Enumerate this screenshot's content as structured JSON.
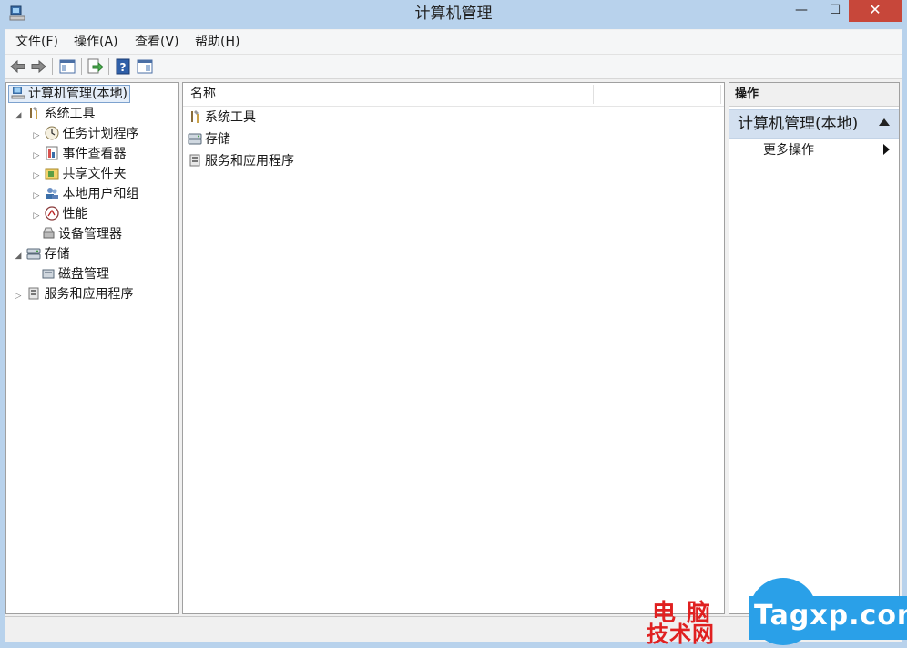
{
  "window": {
    "title": "计算机管理",
    "min_glyph": "—",
    "max_glyph": "☐",
    "close_glyph": "✕"
  },
  "menu": [
    "文件(F)",
    "操作(A)",
    "查看(V)",
    "帮助(H)"
  ],
  "toolbar": [
    "back-arrow-icon",
    "forward-arrow-icon",
    "console-tree-icon",
    "export-list-icon",
    "help-icon",
    "action-pane-icon"
  ],
  "tree": {
    "root": "计算机管理(本地)",
    "items": [
      {
        "label": "系统工具",
        "expanded": true
      },
      {
        "label": "任务计划程序"
      },
      {
        "label": "事件查看器"
      },
      {
        "label": "共享文件夹"
      },
      {
        "label": "本地用户和组"
      },
      {
        "label": "性能"
      },
      {
        "label": "设备管理器"
      },
      {
        "label": "存储",
        "expanded": true
      },
      {
        "label": "磁盘管理"
      },
      {
        "label": "服务和应用程序"
      }
    ]
  },
  "list": {
    "column_name": "名称",
    "rows": [
      "系统工具",
      "存储",
      "服务和应用程序"
    ]
  },
  "actions": {
    "header": "操作",
    "section": "计算机管理(本地)",
    "more": "更多操作"
  },
  "watermark": {
    "line1": "电脑",
    "line2": "技术网",
    "brand": "Tagxp.com"
  },
  "colors": {
    "titlebar": "#b8d2ec",
    "close": "#c7473a",
    "selection": "#d3e0f0",
    "watermark_blue": "#2aa0e8",
    "watermark_red": "#e02020"
  }
}
